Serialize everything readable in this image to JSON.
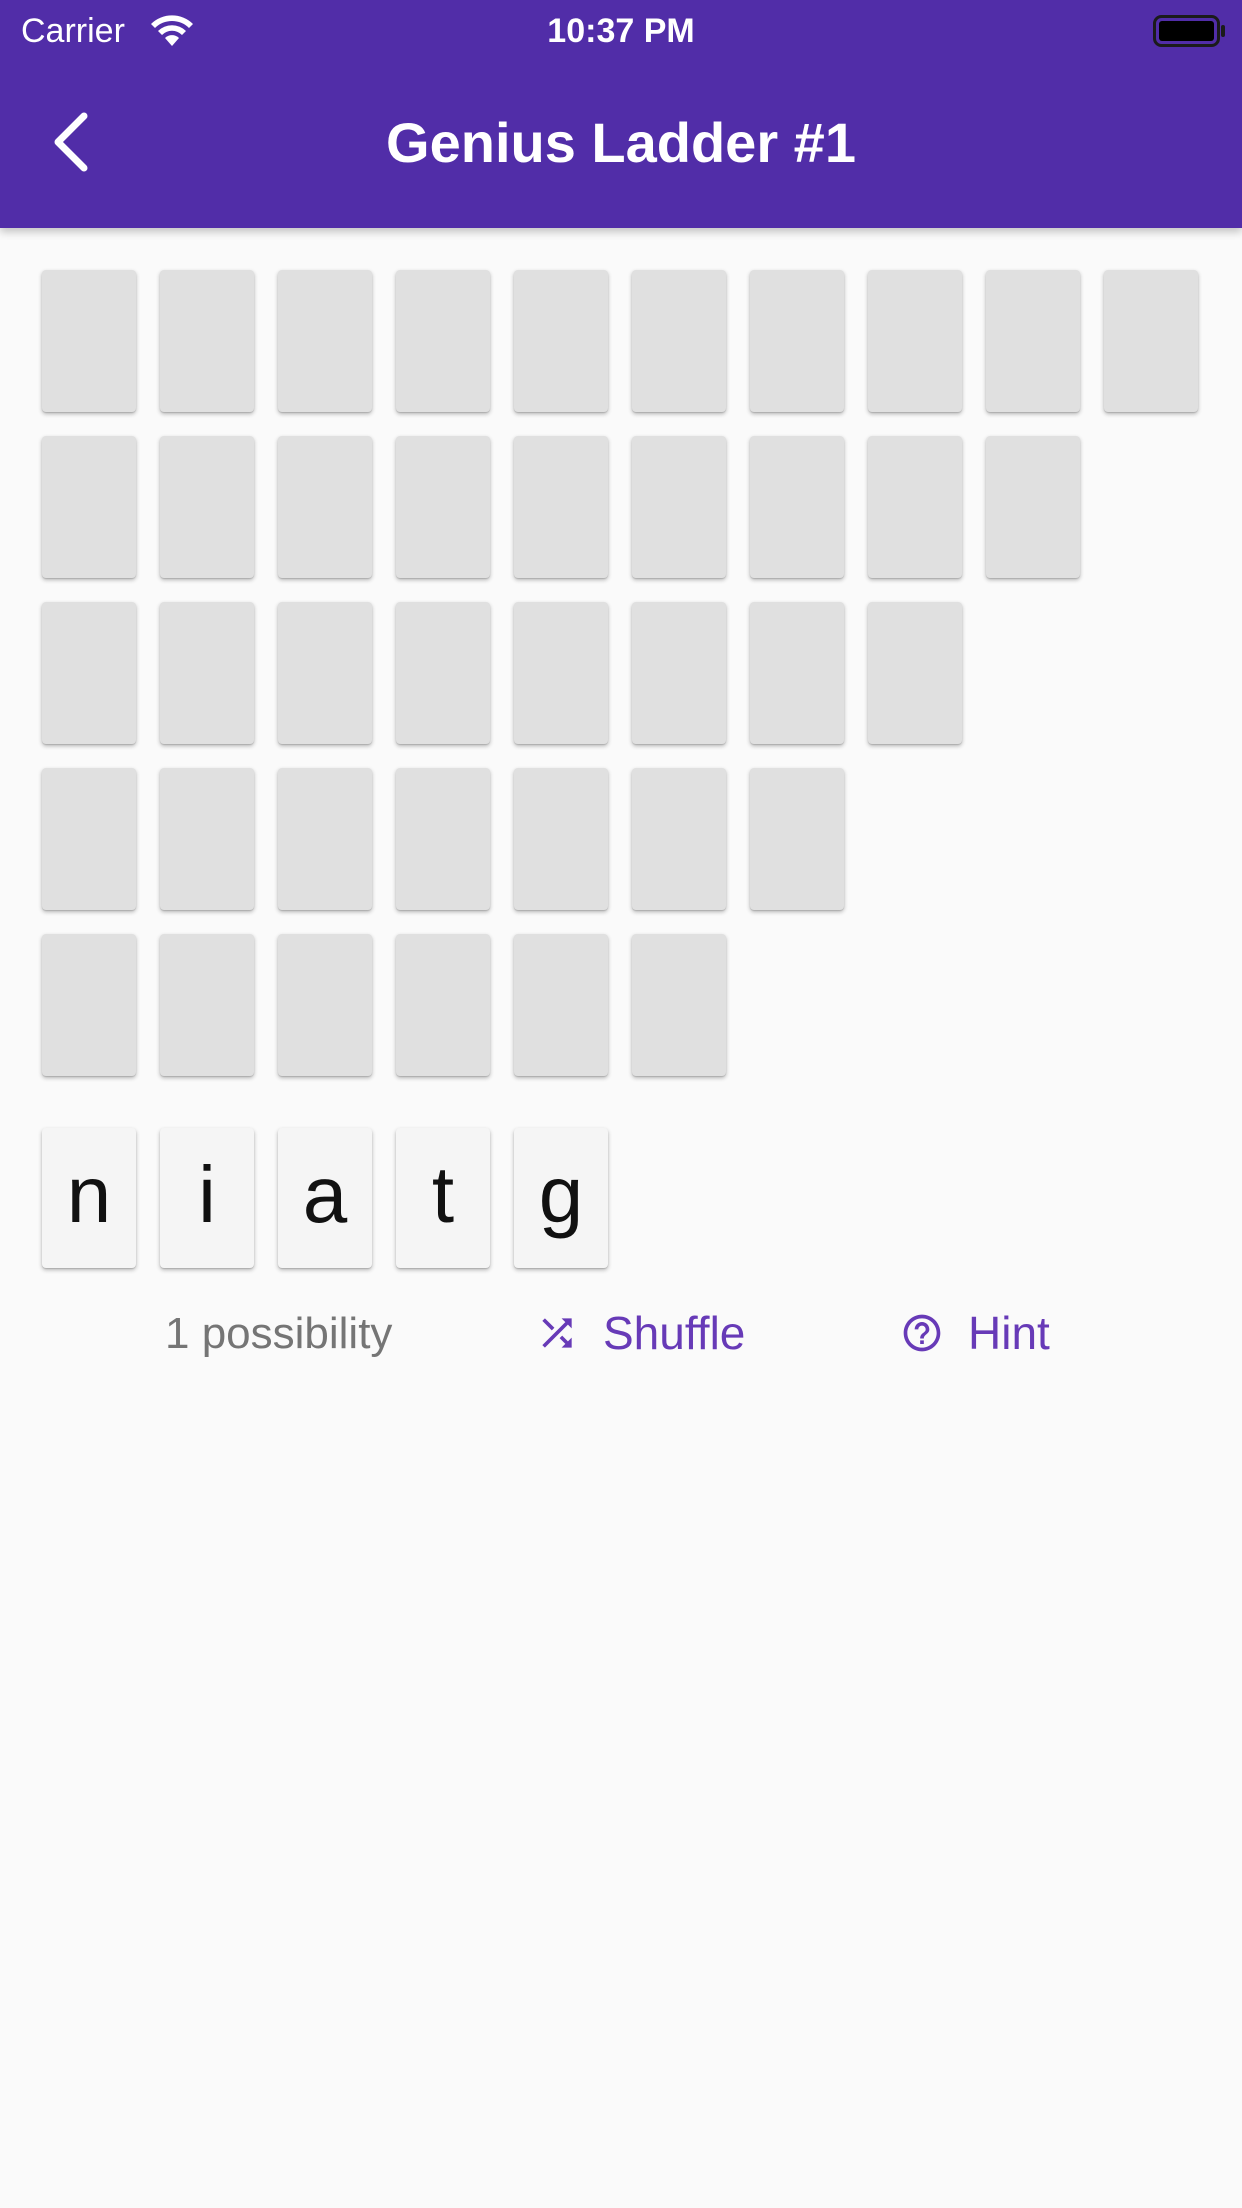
{
  "status_bar": {
    "carrier": "Carrier",
    "time": "10:37 PM",
    "wifi_icon": "wifi-icon",
    "battery_icon": "battery-icon"
  },
  "app_bar": {
    "title": "Genius Ladder #1",
    "back_icon": "chevron-left-icon",
    "background_color": "#512da8"
  },
  "board": {
    "row_lengths": [
      10,
      9,
      8,
      7,
      6
    ],
    "tile_color": "#e0e0e0"
  },
  "letters": [
    "n",
    "i",
    "a",
    "t",
    "g"
  ],
  "footer": {
    "possibilities": "1 possibility",
    "shuffle_label": "Shuffle",
    "shuffle_icon": "shuffle-icon",
    "hint_label": "Hint",
    "hint_icon": "help-circle-icon",
    "accent_color": "#673ab7"
  }
}
